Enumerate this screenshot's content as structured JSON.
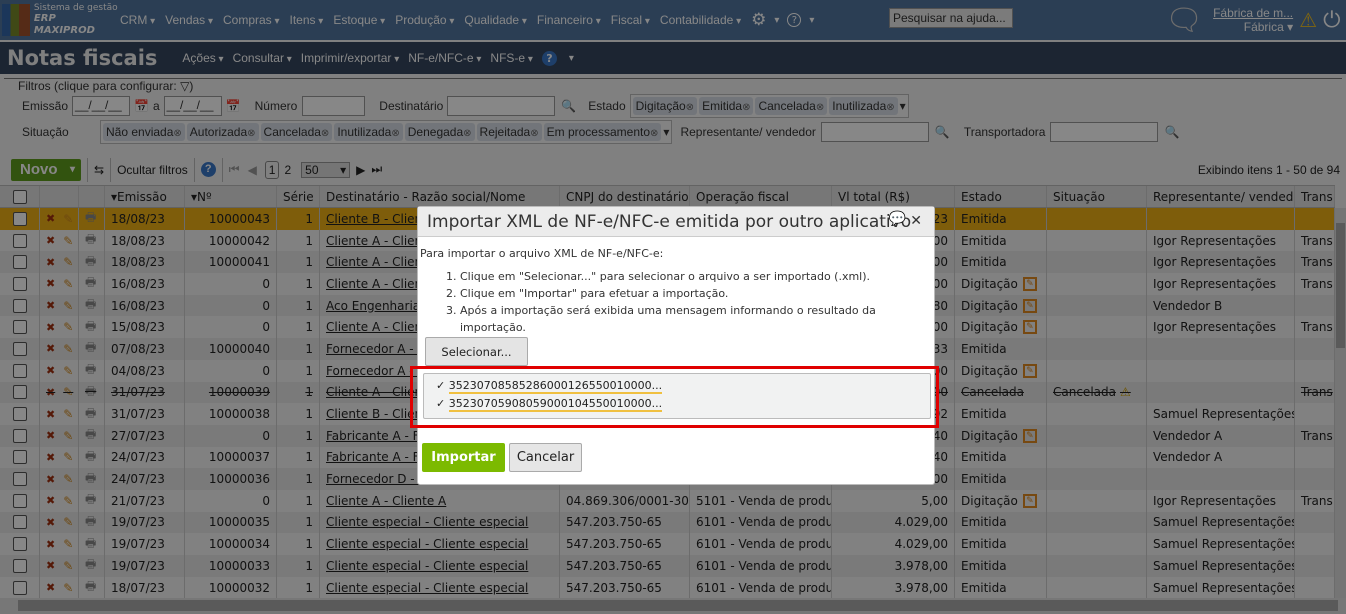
{
  "app": {
    "logo_line1": "Sistema de gestão",
    "logo_line2": "ERP MAXIPROD",
    "menu": [
      "CRM",
      "Vendas",
      "Compras",
      "Itens",
      "Estoque",
      "Produção",
      "Qualidade",
      "Financeiro",
      "Fiscal",
      "Contabilidade"
    ],
    "help_search_placeholder": "Pesquisar na ajuda...",
    "company_link": "Fábrica de m...",
    "company_unit": "Fábrica"
  },
  "page": {
    "title": "Notas fiscais",
    "submenu": [
      "Ações",
      "Consultar",
      "Imprimir/exportar",
      "NF-e/NFC-e",
      "NFS-e"
    ]
  },
  "filters": {
    "legend": "Filtros (clique para configurar:",
    "emissao_label": "Emissão",
    "date_from": "__/__/__",
    "a_label": "a",
    "date_to": "__/__/__",
    "numero_label": "Número",
    "destinatario_label": "Destinatário",
    "estado_label": "Estado",
    "estado_tags": [
      "Digitação",
      "Emitida",
      "Cancelada",
      "Inutilizada"
    ],
    "situacao_label": "Situação",
    "situacao_tags": [
      "Não enviada",
      "Autorizada",
      "Cancelada",
      "Inutilizada",
      "Denegada",
      "Rejeitada",
      "Em processamento"
    ],
    "representante_label": "Representante/ vendedor",
    "transportadora_label": "Transportadora"
  },
  "toolbar": {
    "novo": "Novo",
    "ocultar": "Ocultar filtros",
    "page_current": "1",
    "page_next": "2",
    "page_size": "50",
    "showing": "Exibindo itens 1 - 50 de 94"
  },
  "columns": [
    "",
    "",
    "",
    "Emissão",
    "Nº",
    "Série",
    "Destinatário - Razão social/Nome",
    "CNPJ do destinatário",
    "Operação fiscal",
    "Vl total (R$)",
    "Estado",
    "Situação",
    "Representante/ vendedor",
    "Trans"
  ],
  "rows": [
    {
      "d": "18/08/23",
      "n": "10000043",
      "s": "1",
      "dest": "Cliente B - Clien",
      "cnpj": "",
      "op": "",
      "vl": "23",
      "est": "Emitida",
      "sit": "",
      "rep": "",
      "tr": "",
      "selected": true
    },
    {
      "d": "18/08/23",
      "n": "10000042",
      "s": "1",
      "dest": "Cliente A - Client",
      "cnpj": "",
      "op": "",
      "vl": "00",
      "est": "Emitida",
      "sit": "",
      "rep": "Igor Representações",
      "tr": "Trans"
    },
    {
      "d": "18/08/23",
      "n": "10000041",
      "s": "1",
      "dest": "Cliente A - Client",
      "cnpj": "",
      "op": "",
      "vl": "00",
      "est": "Emitida",
      "sit": "",
      "rep": "Igor Representações",
      "tr": "Trans"
    },
    {
      "d": "16/08/23",
      "n": "0",
      "s": "1",
      "dest": "Cliente A - Client",
      "cnpj": "",
      "op": "",
      "vl": "00",
      "est": "Digitação",
      "sit": "",
      "rep": "Igor Representações",
      "tr": "Trans"
    },
    {
      "d": "16/08/23",
      "n": "0",
      "s": "1",
      "dest": "Aco Engenharia -",
      "cnpj": "",
      "op": "",
      "vl": "80",
      "est": "Digitação",
      "sit": "",
      "rep": "Vendedor B",
      "tr": ""
    },
    {
      "d": "15/08/23",
      "n": "0",
      "s": "1",
      "dest": "Cliente A - Client",
      "cnpj": "",
      "op": "",
      "vl": "00",
      "est": "Digitação",
      "sit": "",
      "rep": "Igor Representações",
      "tr": "Trans"
    },
    {
      "d": "07/08/23",
      "n": "10000040",
      "s": "1",
      "dest": "Fornecedor A - F",
      "cnpj": "",
      "op": "",
      "vl": "33",
      "est": "Emitida",
      "sit": "",
      "rep": "",
      "tr": ""
    },
    {
      "d": "04/08/23",
      "n": "0",
      "s": "1",
      "dest": "Fornecedor A - F",
      "cnpj": "",
      "op": "",
      "vl": "00",
      "est": "Digitação",
      "sit": "",
      "rep": "",
      "tr": ""
    },
    {
      "d": "31/07/23",
      "n": "10000039",
      "s": "1",
      "dest": "Cliente A - Clien",
      "cnpj": "",
      "op": "",
      "vl": "00",
      "est": "Cancelada",
      "sit": "Cancelada",
      "rep": "",
      "tr": "Trans",
      "strike": true
    },
    {
      "d": "31/07/23",
      "n": "10000038",
      "s": "1",
      "dest": "Cliente B - Clien",
      "cnpj": "",
      "op": "",
      "vl": "92",
      "est": "Emitida",
      "sit": "",
      "rep": "Samuel Representações",
      "tr": ""
    },
    {
      "d": "27/07/23",
      "n": "0",
      "s": "1",
      "dest": "Fabricante A - Fa",
      "cnpj": "",
      "op": "",
      "vl": "40",
      "est": "Digitação",
      "sit": "",
      "rep": "Vendedor A",
      "tr": "Trans"
    },
    {
      "d": "24/07/23",
      "n": "10000037",
      "s": "1",
      "dest": "Fabricante A - Fa",
      "cnpj": "",
      "op": "",
      "vl": "40",
      "est": "Emitida",
      "sit": "",
      "rep": "Vendedor A",
      "tr": ""
    },
    {
      "d": "24/07/23",
      "n": "10000036",
      "s": "1",
      "dest": "Fornecedor D - F",
      "cnpj": "",
      "op": "",
      "vl": "00",
      "est": "Emitida",
      "sit": "",
      "rep": "",
      "tr": ""
    },
    {
      "d": "21/07/23",
      "n": "0",
      "s": "1",
      "dest": "Cliente A - Cliente A",
      "cnpj": "04.869.306/0001-30",
      "op": "5101 - Venda de produ...",
      "vl": "5,00",
      "est": "Digitação",
      "sit": "",
      "rep": "Igor Representações",
      "tr": "Trans"
    },
    {
      "d": "19/07/23",
      "n": "10000035",
      "s": "1",
      "dest": "Cliente especial - Cliente especial",
      "cnpj": "547.203.750-65",
      "op": "6101 - Venda de produ...",
      "vl": "4.029,00",
      "est": "Emitida",
      "sit": "",
      "rep": "Samuel Representações",
      "tr": ""
    },
    {
      "d": "19/07/23",
      "n": "10000034",
      "s": "1",
      "dest": "Cliente especial - Cliente especial",
      "cnpj": "547.203.750-65",
      "op": "6101 - Venda de produ...",
      "vl": "4.029,00",
      "est": "Emitida",
      "sit": "",
      "rep": "Samuel Representações",
      "tr": ""
    },
    {
      "d": "19/07/23",
      "n": "10000033",
      "s": "1",
      "dest": "Cliente especial - Cliente especial",
      "cnpj": "547.203.750-65",
      "op": "6101 - Venda de produ...",
      "vl": "3.978,00",
      "est": "Emitida",
      "sit": "",
      "rep": "Samuel Representações",
      "tr": ""
    },
    {
      "d": "18/07/23",
      "n": "10000032",
      "s": "1",
      "dest": "Cliente especial - Cliente especial",
      "cnpj": "547.203.750-65",
      "op": "6101 - Venda de produ...",
      "vl": "3.978,00",
      "est": "Emitida",
      "sit": "",
      "rep": "Samuel Representações",
      "tr": ""
    }
  ],
  "modal": {
    "title": "Importar XML de NF-e/NFC-e emitida por outro aplicativo",
    "intro": "Para importar o arquivo XML de NF-e/NFC-e:",
    "steps": [
      "Clique em \"Selecionar...\" para selecionar o arquivo a ser importado (.xml).",
      "Clique em \"Importar\" para efetuar a importação.",
      "Após a importação será exibida uma mensagem informando o resultado da importação."
    ],
    "select_button": "Selecionar...",
    "files": [
      "352307085852860001265500100…",
      "352307059080590001045500100…"
    ],
    "files_display": [
      "35230708585286000126550010000...",
      "35230705908059000104550010000..."
    ],
    "import_button": "Importar",
    "cancel_button": "Cancelar"
  },
  "colors": {
    "topbar": "#52759f",
    "titlebar": "#35465f",
    "selected_row": "#eeb015",
    "novo": "#5f9e1e",
    "import": "#7cba00",
    "highlight": "#e00000"
  }
}
